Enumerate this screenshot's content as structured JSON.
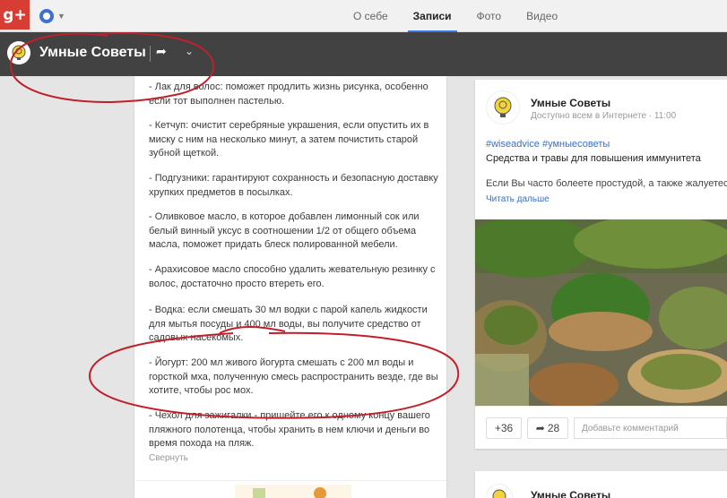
{
  "topbar": {
    "tabs": [
      {
        "label": "О себе",
        "active": false
      },
      {
        "label": "Записи",
        "active": true
      },
      {
        "label": "Фото",
        "active": false
      },
      {
        "label": "Видео",
        "active": false
      }
    ]
  },
  "page": {
    "title": "Умные Советы"
  },
  "left_post": {
    "paragraphs": [
      "- Лак для волос: поможет продлить жизнь рисунка, особенно если тот выполнен пастелью.",
      "- Кетчуп: очистит серебряные украшения, если опустить их в миску с ним на несколько минут, а затем почистить старой зубной щеткой.",
      "- Подгузники: гарантируют сохранность и безопасную доставку хрупких предметов в посылках.",
      "- Оливковое масло, в которое добавлен лимонный сок или белый винный уксус в соотношении 1/2 от общего объема масла, поможет придать блеск полированной мебели.",
      "- Арахисовое масло способно удалить жевательную резинку с волос, достаточно просто втереть его.",
      "- Водка: если смешать 30 мл водки с парой капель жидкости для мытья посуды и 400 мл воды, вы получите средство от садовых насекомых.",
      "- Йогурт: 200 мл живого йогурта смешать с 200 мл воды и горсткой мха, полученную смесь распространить везде, где вы хотите, чтобы рос мох.",
      "- Чехол для зажигалки - пришейте его к одному концу вашего пляжного полотенца, чтобы хранить в нем ключи и деньги во время похода на пляж."
    ],
    "collapse_label": "Свернуть"
  },
  "right_post": {
    "author": "Умные Советы",
    "meta": "Доступно всем в Интернете  ·  11:00",
    "tags": "#wiseadvice #умныесоветы",
    "heading": "Средства и травы для повышения иммунитета",
    "excerpt": "Если Вы часто болеете простудой, а также жалуетесь",
    "read_more": "Читать дальше",
    "plus_count": "+36",
    "share_count": "28",
    "comment_placeholder": "Добавьте комментарий"
  },
  "right_post2": {
    "author": "Умные Советы"
  },
  "colors": {
    "gplus_red": "#d73d32",
    "header_dark": "#424242",
    "link_blue": "#3b6fc6",
    "annotation_red": "#c0202a"
  },
  "icons": [
    "google-plus-logo-icon",
    "account-switcher-icon",
    "lightbulb-logo-icon",
    "share-arrow-icon",
    "chevron-down-icon"
  ]
}
